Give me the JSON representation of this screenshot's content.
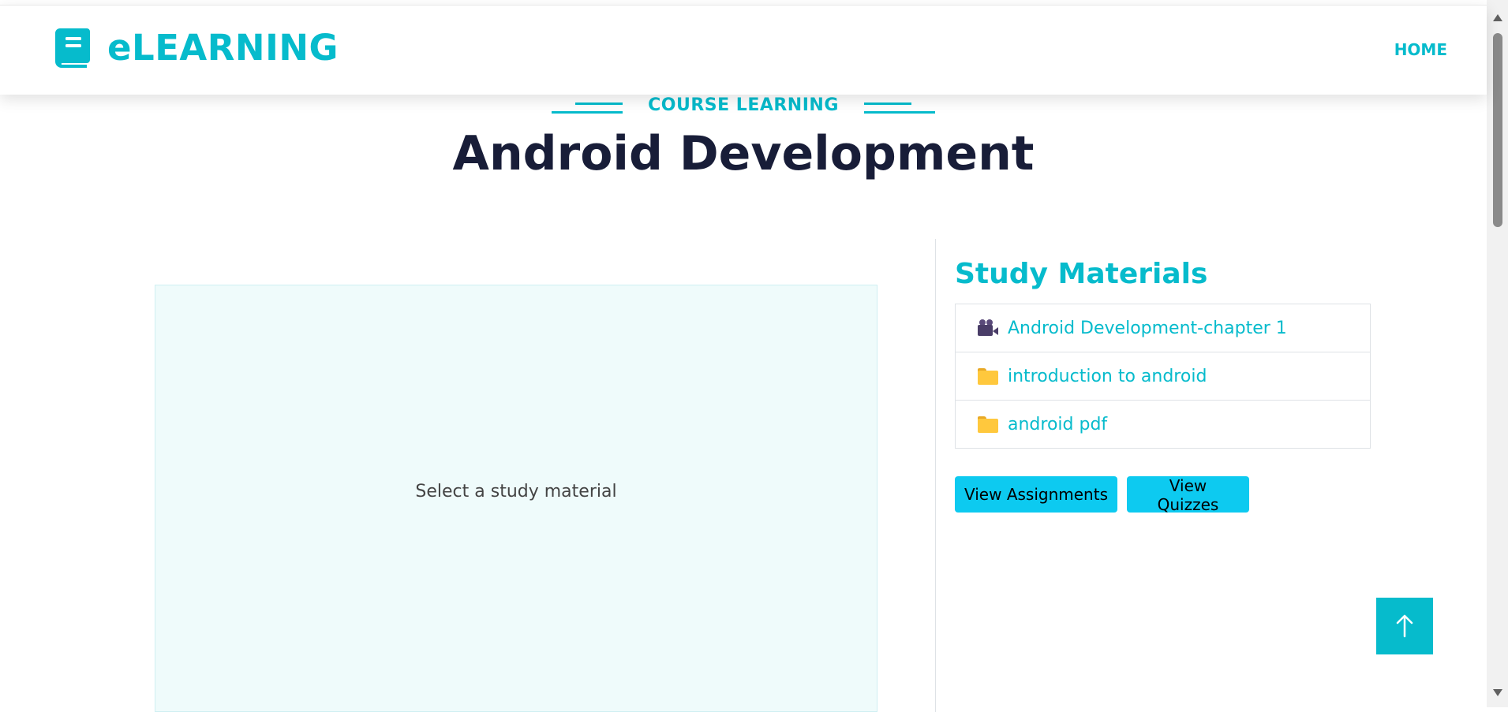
{
  "header": {
    "brand": "eLEARNING",
    "brand_icon": "book-icon",
    "nav_home": "HOME"
  },
  "section": {
    "tag": "COURSE LEARNING",
    "title": "Android Development"
  },
  "viewer": {
    "placeholder": "Select a study material"
  },
  "materials": {
    "title": "Study Materials",
    "items": [
      {
        "icon": "video-camera-icon",
        "label": "Android Development-chapter 1"
      },
      {
        "icon": "folder-icon",
        "label": "introduction to android"
      },
      {
        "icon": "folder-icon",
        "label": "android pdf"
      }
    ]
  },
  "actions": {
    "assignments": "View Assignments",
    "quizzes": "View Quizzes"
  },
  "colors": {
    "accent": "#06bbcc",
    "dark": "#181d38",
    "button": "#0dcaf0",
    "viewer_bg": "#effbfb"
  }
}
